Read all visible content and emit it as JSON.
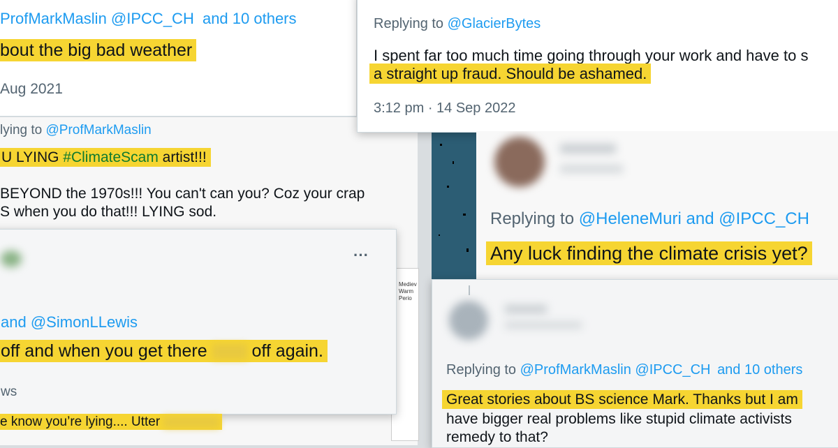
{
  "card_a": {
    "reply_users": "ProfMarkMaslin @IPCC_CH",
    "reply_others": "and 10 others",
    "text": "bout the big bad weather",
    "date": "Aug 2021"
  },
  "card_b": {
    "replying_prefix": "Replying to",
    "replying_user": "@GlacierBytes",
    "text_line1": "I spent far too much time going through your work and have to s",
    "text_line2": "a straight up fraud. Should be ashamed.",
    "timestamp": "3:12 pm · 14 Sep 2022"
  },
  "card_c": {
    "replying_prefix": "lying to",
    "replying_user": "@ProfMarkMaslin",
    "text_pre": "U LYING ",
    "hashtag": "#ClimateScam",
    "text_post": " artist!!!",
    "line2": "BEYOND the 1970s!!! You can't can you? Coz your crap",
    "line3": "S when you do that!!! LYING sod."
  },
  "card_d": {
    "more": "···",
    "replying_connector": "and",
    "replying_user": "@SimonLLewis",
    "text_pre": "off and when you get there",
    "text_post": "off again.",
    "meta": "ws",
    "thumb_label": "Mediev Warm Perio"
  },
  "card_e": {
    "replying_prefix": "Replying to",
    "replying_user1": "@HeleneMuri",
    "replying_and": "and",
    "replying_user2": "@IPCC_CH",
    "text": "Any luck finding the climate crisis yet?"
  },
  "card_f": {
    "replying_prefix": "Replying to",
    "replying_users": "@ProfMarkMaslin @IPCC_CH",
    "replying_others": "and 10 others",
    "line1": "Great stories about BS science Mark. Thanks but I am",
    "line2": "have bigger real problems like stupid climate activists",
    "line3": "remedy to that?"
  },
  "fragment": {
    "text": "e know you’re lying.... Utter"
  }
}
